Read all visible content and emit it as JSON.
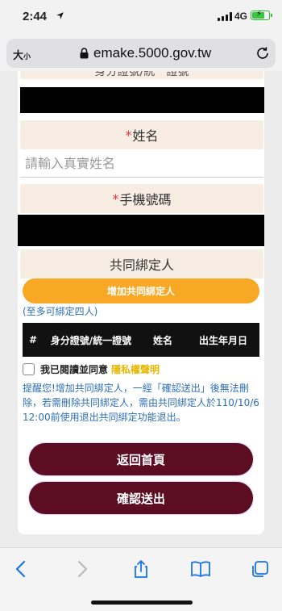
{
  "status_bar": {
    "time": "2:44",
    "network": "4G"
  },
  "browser": {
    "text_size_label": "大",
    "text_size_small": "小",
    "url": "emake.5000.gov.tw"
  },
  "form": {
    "partial_label": "身分證號/統一證號",
    "name_label": "姓名",
    "name_placeholder": "請輸入真實姓名",
    "phone_label": "手機號碼",
    "required_mark": "*",
    "co_binder_heading": "共同綁定人",
    "add_button": "增加共同綁定人",
    "add_hint": "(至多可綁定四人)",
    "table_headers": [
      "#",
      "身分證號/統一證號",
      "姓名",
      "出生年月日"
    ],
    "agree_text": "我已閱讀並同意",
    "privacy_link": "隱私權聲明",
    "notice": "提醒您!增加共同綁定人，一經「確認送出」後無法刪除，若需刪除共同綁定人，需由共同綁定人於110/10/6 12:00前使用退出共同綁定功能退出。",
    "back_button": "返回首頁",
    "submit_button": "確認送出"
  },
  "colors": {
    "accent_orange": "#f9a825",
    "dark_button": "#5c0d22",
    "link_blue": "#2d6fb7",
    "privacy_yellow": "#e6b800",
    "required_red": "#e53935",
    "label_bg": "#f7ede3"
  }
}
